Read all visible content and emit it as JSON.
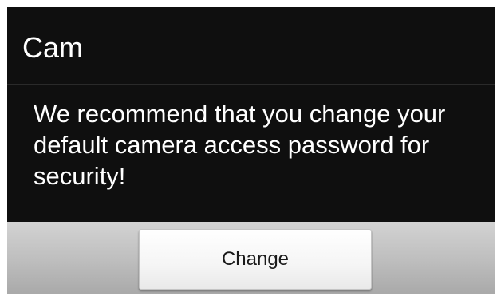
{
  "dialog": {
    "title": "Cam",
    "message": "We recommend that you change your default camera access password for security!",
    "buttons": {
      "change_label": "Change"
    }
  },
  "colors": {
    "dialog_background": "#0f0f0f",
    "text_primary": "#ffffff",
    "button_bar": "#bdbdbd",
    "button_background": "#f5f5f5",
    "button_text": "#1a1a1a"
  }
}
